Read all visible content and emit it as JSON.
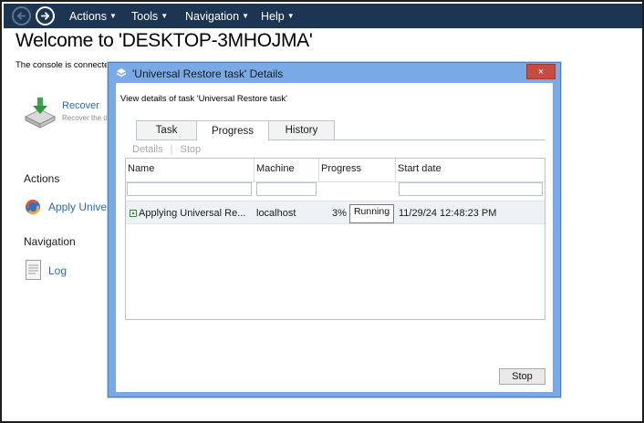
{
  "menubar": {
    "items": [
      {
        "label": "Actions"
      },
      {
        "label": "Tools"
      },
      {
        "label": "Navigation"
      },
      {
        "label": "Help"
      }
    ]
  },
  "page": {
    "title": "Welcome to 'DESKTOP-3MHOJMA'",
    "intro": "The console is connected to a managed machine. Choose the action to perform or the tool to use.",
    "recover": {
      "label": "Recover",
      "description": "Recover the data"
    },
    "actions_heading": "Actions",
    "apply_label": "Apply Universal Restore",
    "navigation_heading": "Navigation",
    "log_label": "Log"
  },
  "dialog": {
    "title": "'Universal Restore task' Details",
    "close_label": "×",
    "heading": "View details of task 'Universal Restore task'",
    "tabs": [
      {
        "label": "Task"
      },
      {
        "label": "Progress"
      },
      {
        "label": "History"
      }
    ],
    "toolbar": {
      "details": "Details",
      "stop": "Stop"
    },
    "grid": {
      "columns": [
        "Name",
        "Machine",
        "Progress",
        "Start date"
      ],
      "rows": [
        {
          "name": "Applying Universal Re...",
          "machine": "localhost",
          "progress": "3%",
          "progress_value": 0.03,
          "status": "Running",
          "start_date": "11/29/24 12:48:23 PM"
        }
      ]
    },
    "stop_button": "Stop"
  },
  "colors": {
    "menubar": "#1b3553",
    "dialog_frame": "#7aaae5",
    "close_button": "#c74b3f",
    "link": "#2a6bb3"
  },
  "icons": [
    "back-arrow-icon",
    "forward-arrow-icon",
    "recover-icon",
    "apply-universal-restore-icon",
    "log-icon",
    "dialog-title-icon",
    "status-running-icon"
  ]
}
